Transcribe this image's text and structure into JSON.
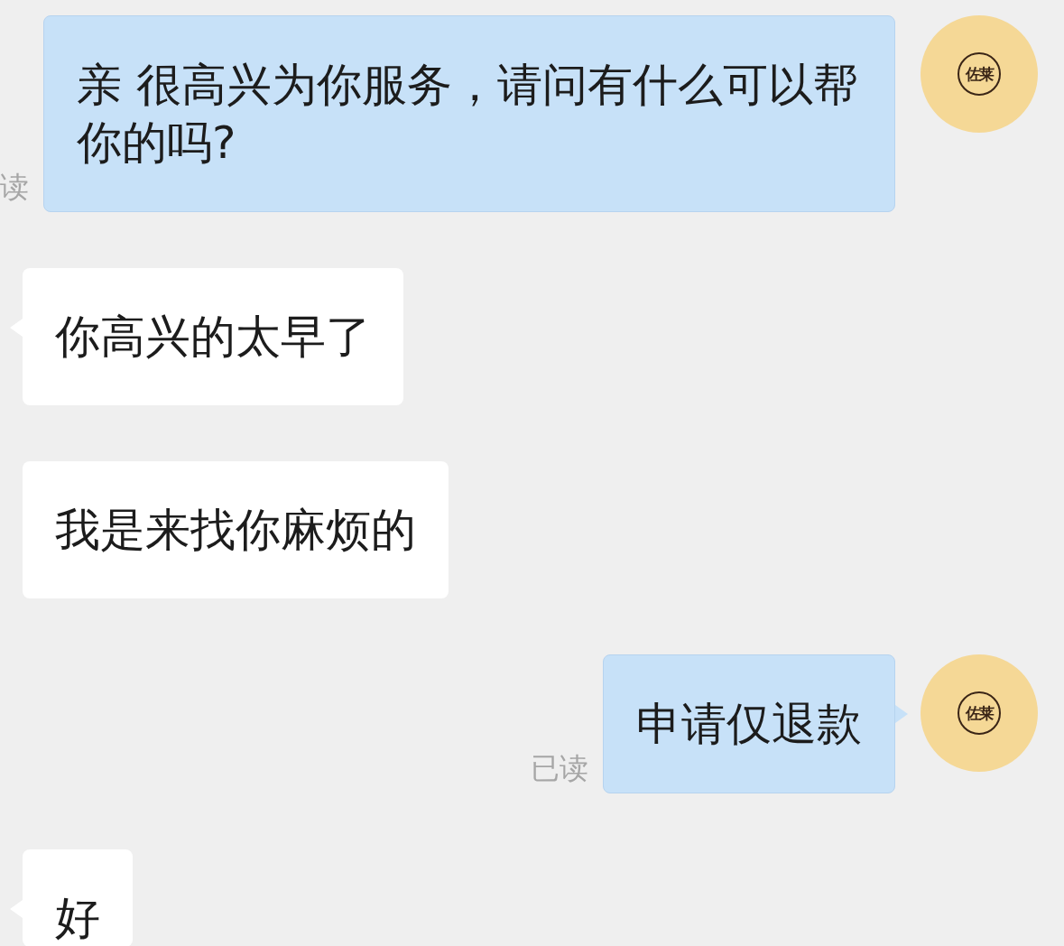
{
  "messages": [
    {
      "kind": "outgoing",
      "text": "亲 很高兴为你服务，请问有什么可以帮你的吗?",
      "read_status": "读",
      "tail": false,
      "avatar": {
        "logo_text": "佐莱"
      }
    },
    {
      "kind": "incoming",
      "text": "你高兴的太早了",
      "tail": true
    },
    {
      "kind": "incoming",
      "text": "我是来找你麻烦的",
      "tail": false
    },
    {
      "kind": "outgoing",
      "text": "申请仅退款",
      "read_status": "已读",
      "tail": true,
      "avatar": {
        "logo_text": "佐莱"
      }
    },
    {
      "kind": "incoming",
      "text": "好",
      "tail": true
    }
  ]
}
